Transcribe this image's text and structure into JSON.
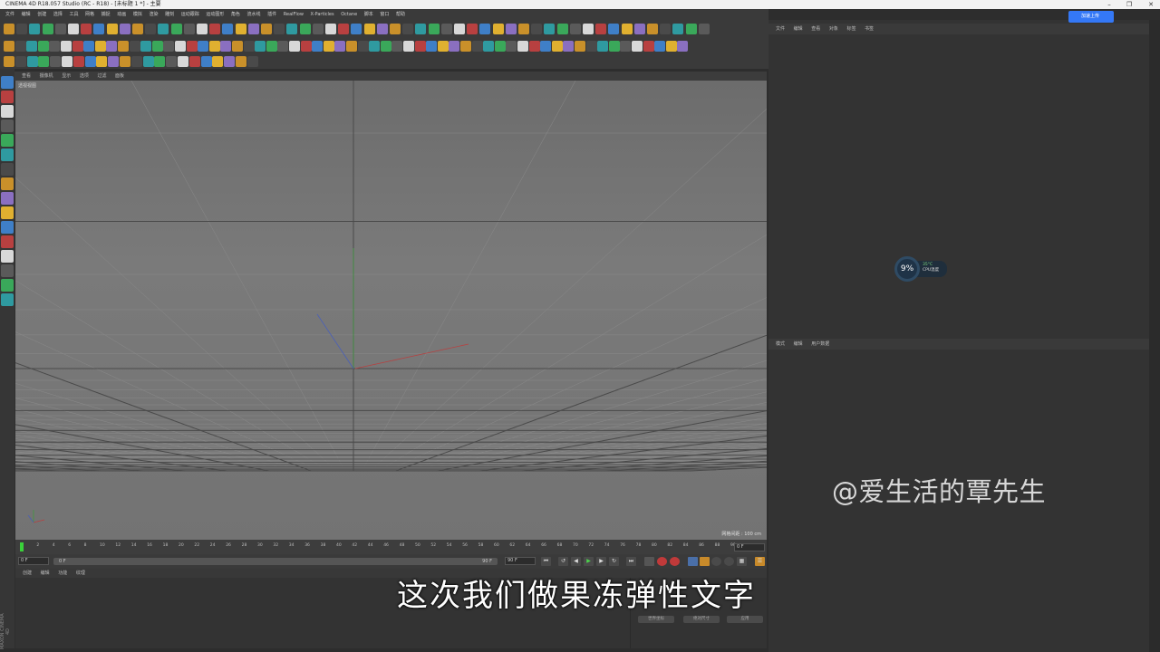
{
  "window": {
    "title": "CINEMA 4D R18.057 Studio (RC - R18) - [未标题 1 *] - 主要"
  },
  "menubar": [
    "文件",
    "编辑",
    "创建",
    "选择",
    "工具",
    "网格",
    "捕捉",
    "动画",
    "模拟",
    "渲染",
    "雕刻",
    "运动跟踪",
    "运动图形",
    "角色",
    "流水线",
    "插件",
    "RealFlow",
    "X-Particles",
    "Octane",
    "脚本",
    "窗口",
    "帮助"
  ],
  "viewport": {
    "menu": [
      "查看",
      "摄像机",
      "显示",
      "选项",
      "过滤",
      "面板"
    ],
    "label": "透视视图",
    "grid_spacing": "网格间距 : 100 cm"
  },
  "timeline": {
    "ticks": [
      "0",
      "2",
      "4",
      "6",
      "8",
      "10",
      "12",
      "14",
      "16",
      "18",
      "20",
      "22",
      "24",
      "26",
      "28",
      "30",
      "32",
      "34",
      "36",
      "38",
      "40",
      "42",
      "44",
      "46",
      "48",
      "50",
      "52",
      "54",
      "56",
      "58",
      "60",
      "62",
      "64",
      "66",
      "68",
      "70",
      "72",
      "74",
      "76",
      "78",
      "80",
      "82",
      "84",
      "86",
      "88",
      "90"
    ],
    "current_frame": "0 F",
    "start_field": "0 F",
    "min_field": "0 F",
    "max_field": "90 F",
    "end_field": "90 F"
  },
  "material_manager": {
    "menu": [
      "创建",
      "编辑",
      "功能",
      "纹理"
    ]
  },
  "coordinates": {
    "buttons": [
      "世界坐标",
      "绝对尺寸",
      "应用"
    ]
  },
  "object_manager": {
    "menu": [
      "文件",
      "编辑",
      "查看",
      "对象",
      "标签",
      "书签"
    ]
  },
  "attribute_manager": {
    "menu": [
      "模式",
      "编辑",
      "用户数据"
    ]
  },
  "cpu_widget": {
    "percent": "9%",
    "temp": "35°C",
    "label": "CPU温度"
  },
  "upload_button": "加速上传",
  "watermark": "@爱生活的覃先生",
  "subtitle": "这次我们做果冻弹性文字",
  "brand": "MAXON CINEMA 4D"
}
